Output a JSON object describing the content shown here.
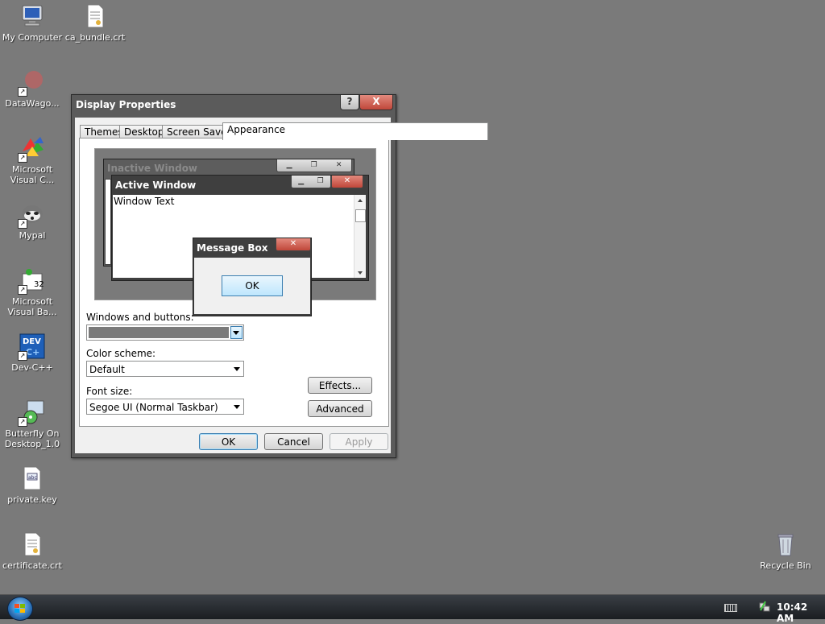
{
  "desktop": {
    "icons": [
      {
        "label": "My Computer"
      },
      {
        "label": "ca_bundle.crt"
      },
      {
        "label": "DataWago..."
      },
      {
        "label": "Microsoft Visual C..."
      },
      {
        "label": "Mypal"
      },
      {
        "label": "Microsoft Visual Ba..."
      },
      {
        "label": "Dev-C++"
      },
      {
        "label": "Butterfly On Desktop_1.0"
      },
      {
        "label": "private.key"
      },
      {
        "label": "certificate.crt"
      },
      {
        "label": "Recycle Bin"
      }
    ]
  },
  "dialog": {
    "title": "Display Properties",
    "help_label": "?",
    "close_label": "X",
    "tabs": [
      "Themes",
      "Desktop",
      "Screen Saver",
      "Appearance"
    ],
    "active_tab": "Appearance",
    "preview": {
      "inactive_title": "Inactive Window",
      "active_title": "Active Window",
      "window_text": "Window Text",
      "message_title": "Message Box",
      "ok_label": "OK"
    },
    "windows_buttons_label": "Windows and buttons:",
    "windows_buttons_value": "",
    "color_scheme_label": "Color scheme:",
    "color_scheme_value": "Default",
    "font_size_label": "Font size:",
    "font_size_value": "Segoe UI (Normal Taskbar)",
    "effects_label": "Effects...",
    "advanced_label": "Advanced",
    "ok_label": "OK",
    "cancel_label": "Cancel",
    "apply_label": "Apply"
  },
  "taskbar": {
    "clock": "10:42 AM"
  },
  "colors": {
    "desktop": "#7a7a7a",
    "title_bar": "#5b5b5b",
    "close_red": "#c0473a"
  }
}
